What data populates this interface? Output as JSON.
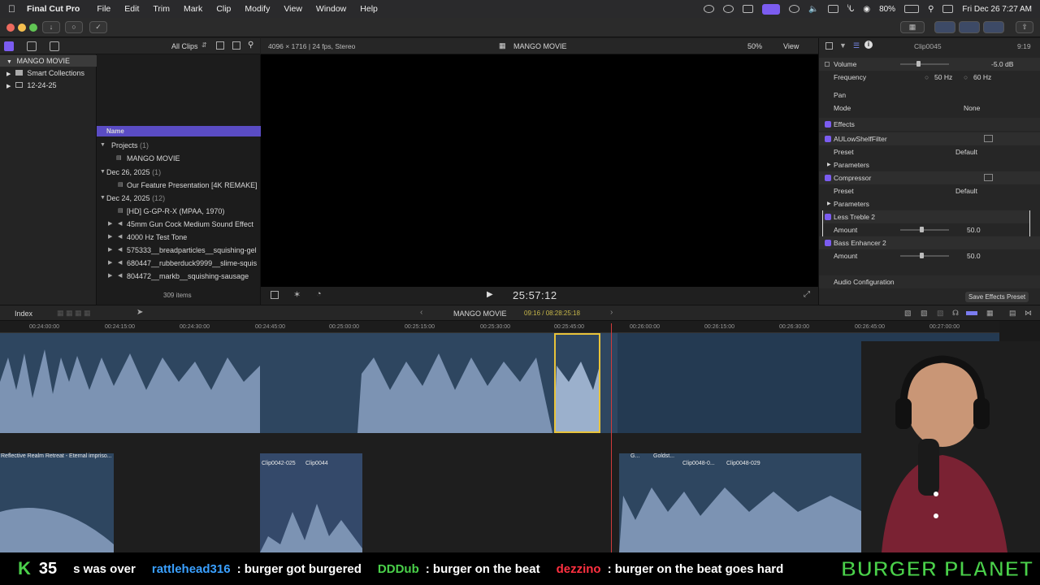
{
  "menubar": {
    "app": "Final Cut Pro",
    "items": [
      "File",
      "Edit",
      "Trim",
      "Mark",
      "Clip",
      "Modify",
      "View",
      "Window",
      "Help"
    ],
    "battery": "80%",
    "datetime": "Fri Dec 26  7:27 AM"
  },
  "library": {
    "root": "MANGO MOVIE",
    "items": [
      "Smart Collections",
      "12-24-25"
    ]
  },
  "browser": {
    "filter": "All Clips",
    "column": "Name",
    "count": "309 items",
    "rows": [
      {
        "label": "Projects",
        "count": "(1)",
        "type": "group"
      },
      {
        "label": "MANGO MOVIE",
        "type": "project"
      },
      {
        "label": "Dec 26, 2025",
        "count": "(1)",
        "type": "group"
      },
      {
        "label": "Our Feature Presentation [4K REMAKE]",
        "type": "clip"
      },
      {
        "label": "Dec 24, 2025",
        "count": "(12)",
        "type": "group"
      },
      {
        "label": "[HD] G-GP-R-X (MPAA, 1970)",
        "type": "clip"
      },
      {
        "label": "45mm Gun Cock Medium Sound Effect",
        "type": "audio"
      },
      {
        "label": "4000 Hz Test Tone",
        "type": "audio"
      },
      {
        "label": "575333__breadparticles__squishing-gel",
        "type": "audio"
      },
      {
        "label": "680447__rubberduck9999__slime-squis",
        "type": "audio"
      },
      {
        "label": "804472__markb__squishing-sausage",
        "type": "audio"
      }
    ]
  },
  "viewer": {
    "format": "4096 × 1716 | 24 fps, Stereo",
    "title": "MANGO MOVIE",
    "zoom": "50%",
    "view": "View",
    "timecode": "25:57:12"
  },
  "inspector": {
    "clip": "Clip0045",
    "duration": "9:19",
    "volume_label": "Volume",
    "volume_value": "-5.0 dB",
    "frequency_label": "Frequency",
    "freq1": "50 Hz",
    "freq2": "60 Hz",
    "pan": "Pan",
    "mode_label": "Mode",
    "mode_value": "None",
    "effects": "Effects",
    "fx": [
      {
        "name": "AULowShelfFilter",
        "preset_label": "Preset",
        "preset": "Default",
        "params": "Parameters"
      },
      {
        "name": "Compressor",
        "preset_label": "Preset",
        "preset": "Default",
        "params": "Parameters"
      }
    ],
    "treble": {
      "name": "Less Treble 2",
      "amount_label": "Amount",
      "amount": "50.0"
    },
    "bass": {
      "name": "Bass Enhancer 2",
      "amount_label": "Amount",
      "amount": "50.0"
    },
    "audio_config": "Audio Configuration",
    "save_preset": "Save Effects Preset"
  },
  "timeline": {
    "index": "Index",
    "project": "MANGO MOVIE",
    "position": "09:16 / 08:28:25:18",
    "ruler": [
      "00:24:00:00",
      "00:24:15:00",
      "00:24:30:00",
      "00:24:45:00",
      "00:25:00:00",
      "00:25:15:00",
      "00:25:30:00",
      "00:25:45:00",
      "00:26:00:00",
      "00:26:15:00",
      "00:26:30:00",
      "00:26:45:00",
      "00:27:00:00"
    ],
    "clips": [
      "Reflective Realm Retreat - Eternal impriso...",
      "Clip0042-025",
      "Clip0044",
      "G...",
      "Goldst...",
      "Clip0048-0...",
      "Clip0048-029"
    ]
  },
  "ticker": {
    "k": "K",
    "kcount": "35",
    "messages": [
      {
        "user": "",
        "text": "s was over"
      },
      {
        "user": "rattlehead316",
        "text": ": burger got burgered",
        "color": "#3aa0ff"
      },
      {
        "user": "DDDub",
        "text": ": burger on the beat",
        "color": "#4ad04a"
      },
      {
        "user": "dezzino",
        "text": ": burger on the beat goes hard",
        "color": "#ff3040"
      }
    ],
    "brand": "BURGER PLANET"
  }
}
